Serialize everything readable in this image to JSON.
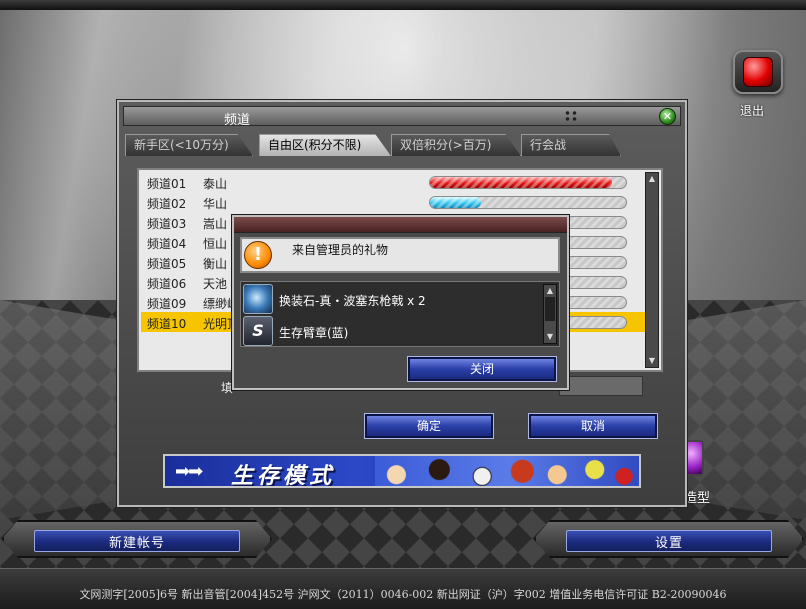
{
  "top_right": {
    "exit_label": "退出"
  },
  "channel_dialog": {
    "title": "频道",
    "tabs": [
      "新手区(<10万分)",
      "自由区(积分不限)",
      "双倍积分(>百万)",
      "行会战"
    ],
    "active_tab": 1,
    "rows": [
      {
        "channel": "频道01",
        "name": "泰山",
        "load": 0.93,
        "color": "red"
      },
      {
        "channel": "频道02",
        "name": "华山",
        "load": 0.26,
        "color": "blue"
      },
      {
        "channel": "频道03",
        "name": "嵩山",
        "load": 0,
        "color": "none"
      },
      {
        "channel": "频道04",
        "name": "恒山",
        "load": 0,
        "color": "none"
      },
      {
        "channel": "频道05",
        "name": "衡山",
        "load": 0,
        "color": "none"
      },
      {
        "channel": "频道06",
        "name": "天池",
        "load": 0,
        "color": "none"
      },
      {
        "channel": "频道09",
        "name": "缥缈峰",
        "load": 0,
        "color": "none"
      },
      {
        "channel": "频道10",
        "name": "光明顶",
        "load": 0,
        "color": "none",
        "selected": true
      }
    ],
    "input_label": "填",
    "confirm_label": "确定",
    "cancel_label": "取消",
    "banner_text": "生存模式",
    "banner_arrows": "➡➡"
  },
  "gift_popup": {
    "message": "来自管理员的礼物",
    "warn_glyph": "!",
    "items": [
      {
        "text": "换装石-真・波塞东枪戟 x 2",
        "icon": "stone-icon"
      },
      {
        "text": "生存臂章(蓝)",
        "icon": "badge-icon",
        "glyph": "S"
      }
    ],
    "close_label": "关闭"
  },
  "side": {
    "right_label": "造型"
  },
  "bottom": {
    "new_account_label": "新建帐号",
    "settings_label": "设置"
  },
  "footer": "文网测字[2005]6号  新出音管[2004]452号  沪网文（2011）0046-002  新出网证（沪）字002  增值业务电信许可证 B2-20090046",
  "colors": {
    "selection": "#f6c500",
    "button_blue": "#2a3fa8",
    "load_red": "#e21b1b",
    "load_blue": "#34c6f2"
  }
}
